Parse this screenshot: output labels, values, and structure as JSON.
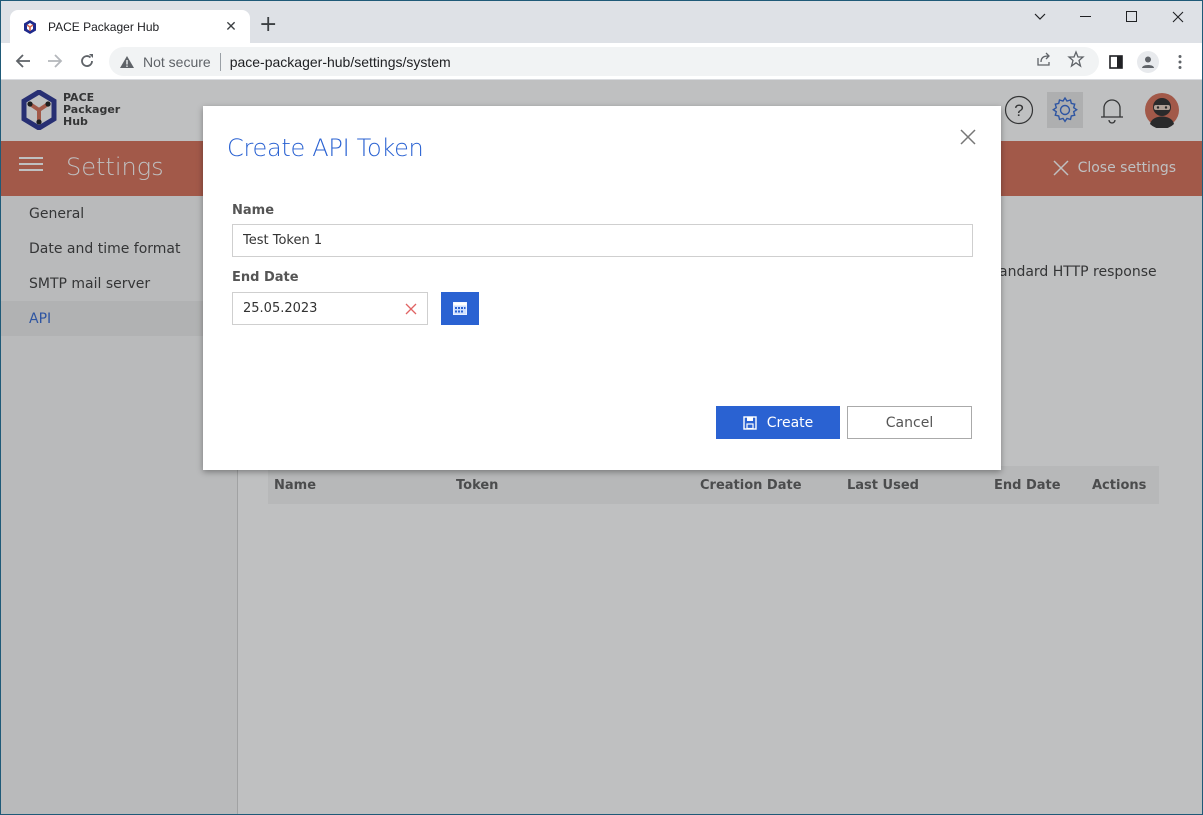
{
  "browser": {
    "tab_title": "PACE Packager Hub",
    "tab_close": "✕",
    "new_tab": "+",
    "security_label": "Not secure",
    "url": "pace-packager-hub/settings/system"
  },
  "app": {
    "logo_lines": [
      "PACE",
      "Packager",
      "Hub"
    ],
    "settings_title": "Settings",
    "close_settings_label": "Close settings",
    "colors": {
      "accent": "#2a62d2",
      "settings_bar": "#d5674f"
    }
  },
  "sidebar": {
    "items": [
      {
        "label": "General",
        "active": false
      },
      {
        "label": "Date and time format",
        "active": false
      },
      {
        "label": "SMTP mail server",
        "active": false
      },
      {
        "label": "API",
        "active": true
      }
    ]
  },
  "main": {
    "description_fragment": "andard HTTP response",
    "table": {
      "columns": [
        "Name",
        "Token",
        "Creation Date",
        "Last Used",
        "End Date",
        "Actions"
      ],
      "rows": []
    }
  },
  "modal": {
    "title": "Create API Token",
    "name_label": "Name",
    "name_value": "Test Token 1",
    "end_date_label": "End Date",
    "end_date_value": "25.05.2023",
    "create_label": "Create",
    "cancel_label": "Cancel"
  }
}
